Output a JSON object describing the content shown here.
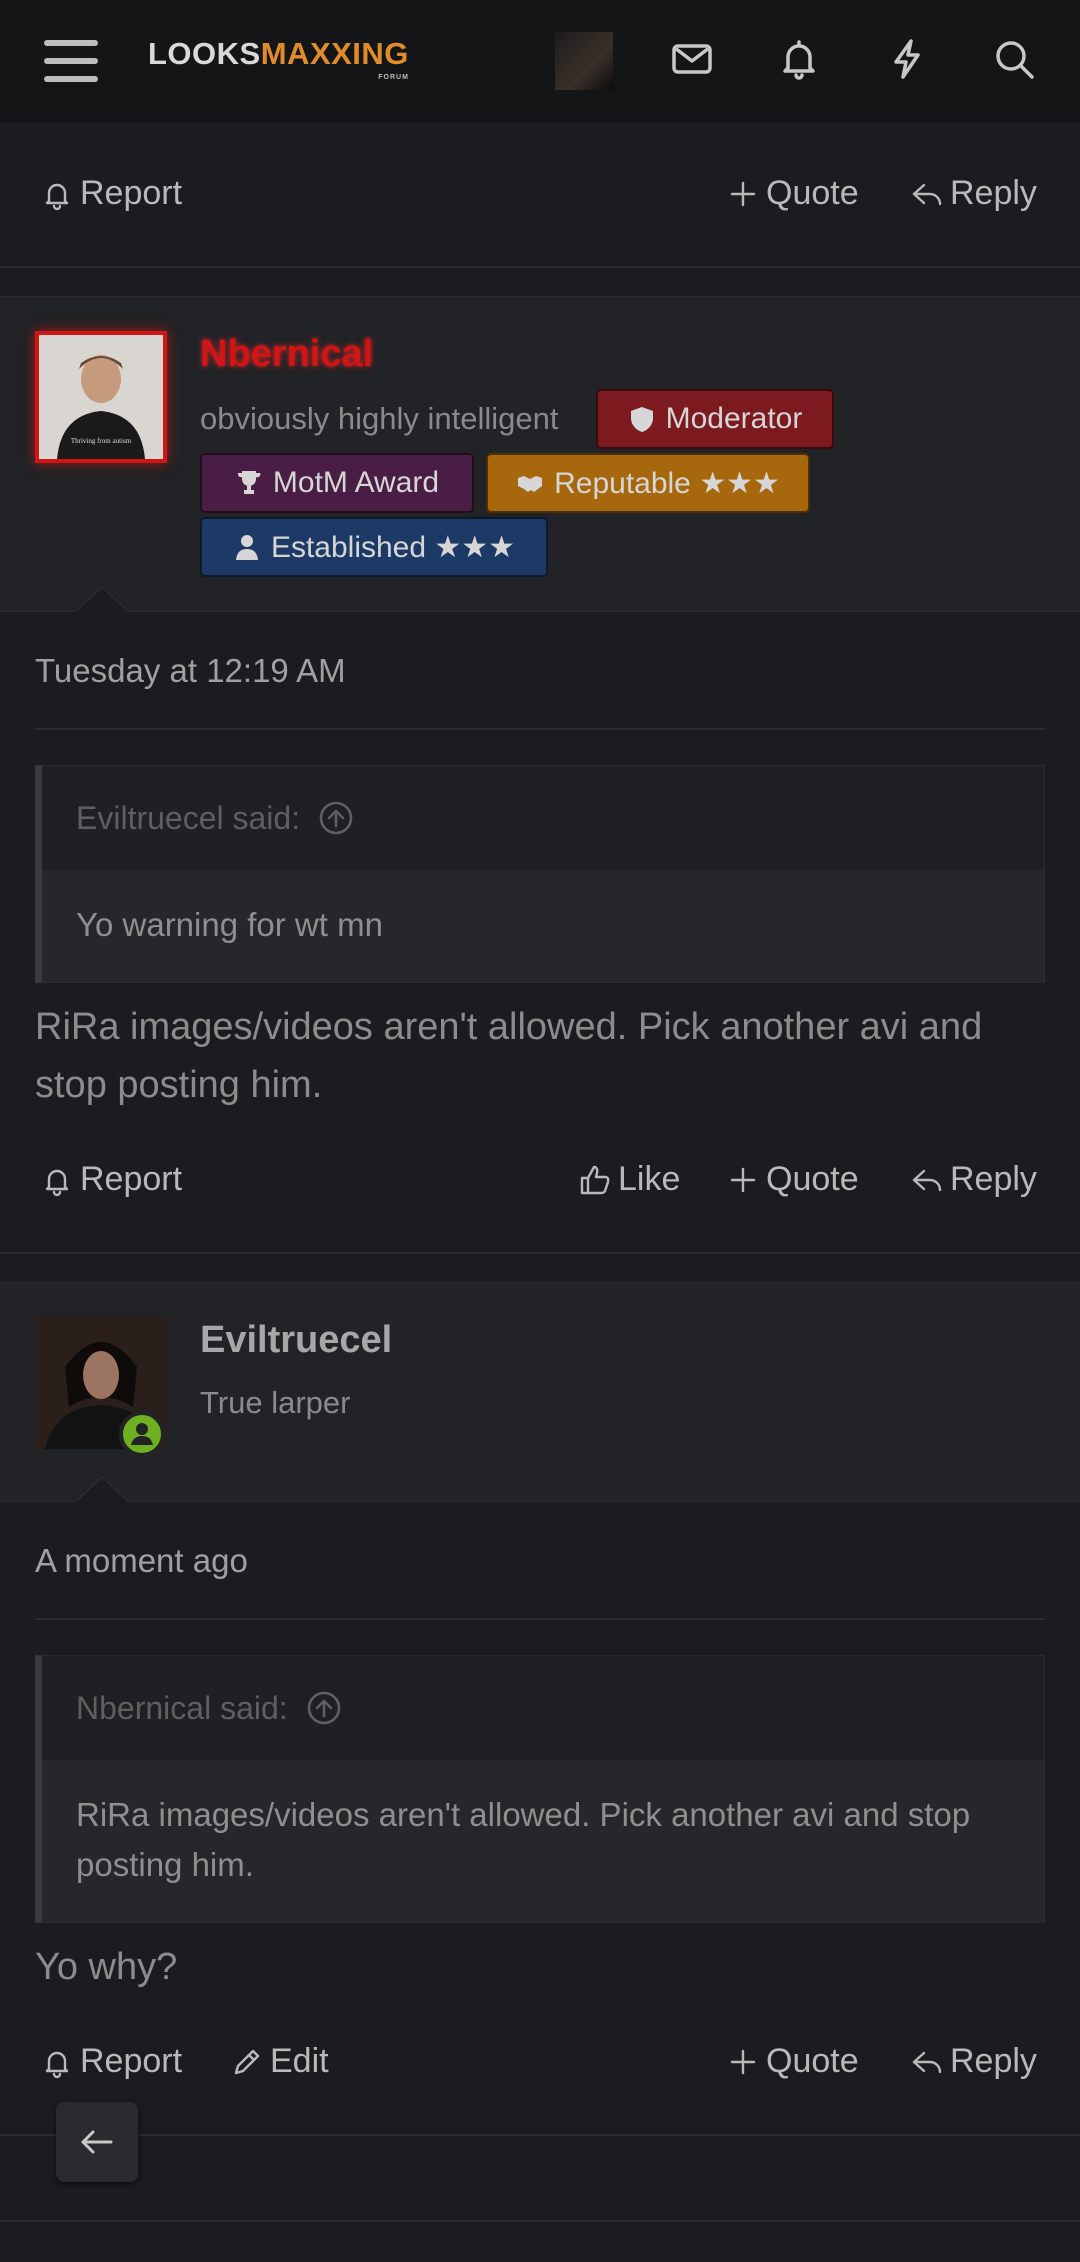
{
  "header": {
    "logo_part1": "LOOKS",
    "logo_part2": "MAXXING",
    "logo_sub": "FORUM",
    "icons": [
      "menu-icon",
      "avatar",
      "mail-icon",
      "bell-icon",
      "bolt-icon",
      "search-icon"
    ]
  },
  "prev_post_actions": {
    "report": "Report",
    "quote": "Quote",
    "reply": "Reply"
  },
  "post1": {
    "username": "Nbernical",
    "username_color": "#d11414",
    "user_title": "obviously highly intelligent",
    "badges": {
      "moderator": "Moderator",
      "motm": "MotM Award",
      "reputable": "Reputable ★★★",
      "established": "Established ★★★"
    },
    "time": "Tuesday at 12:19 AM",
    "quote_author": "Eviltruecel said:",
    "quote_text": "Yo warning for wt mn",
    "body": "RiRa images/videos aren't allowed. Pick another avi and stop posting him.",
    "actions": {
      "report": "Report",
      "like": "Like",
      "quote": "Quote",
      "reply": "Reply"
    }
  },
  "post2": {
    "username": "Eviltruecel",
    "user_title": "True larper",
    "time": "A moment ago",
    "quote_author": "Nbernical said:",
    "quote_text": "RiRa images/videos aren't allowed. Pick another avi and stop posting him.",
    "body": "Yo why?",
    "actions": {
      "report": "Report",
      "edit": "Edit",
      "quote": "Quote",
      "reply": "Reply"
    }
  },
  "colors": {
    "accent_orange": "#e28b2a",
    "moderator_badge": "#7d1a1f",
    "motm_badge": "#4a1e44",
    "reputable_badge": "#a7680d",
    "established_badge": "#1d3a66",
    "online_indicator": "#6fb021"
  }
}
